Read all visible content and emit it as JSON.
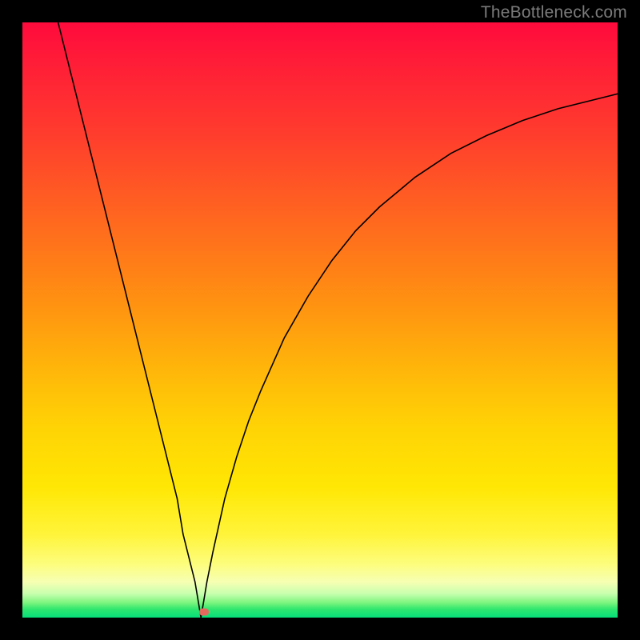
{
  "watermark": "TheBottleneck.com",
  "colors": {
    "background_black": "#000000",
    "curve_stroke": "#000000",
    "marker_fill": "#e46a5e",
    "gradient_stops": [
      "#ff0a3c",
      "#ff1b38",
      "#ff3a2e",
      "#ff6a1e",
      "#ff8e12",
      "#ffb50a",
      "#ffd305",
      "#ffe704",
      "#fff43a",
      "#fdfd7d",
      "#f6ffb3",
      "#c7ffae",
      "#7cf57e",
      "#2fe66e",
      "#05de7a"
    ]
  },
  "chart_data": {
    "type": "line",
    "title": "",
    "xlabel": "",
    "ylabel": "",
    "xlim": [
      0,
      100
    ],
    "ylim": [
      0,
      100
    ],
    "grid": false,
    "series": [
      {
        "name": "left-branch",
        "x": [
          6,
          8,
          10,
          12,
          14,
          16,
          18,
          20,
          22,
          24,
          26,
          27,
          28,
          29,
          29.5,
          30
        ],
        "values": [
          100,
          92,
          84,
          76,
          68,
          60,
          52,
          44,
          36,
          28,
          20,
          14,
          10,
          6,
          3,
          0
        ]
      },
      {
        "name": "right-branch",
        "x": [
          30,
          31,
          32,
          34,
          36,
          38,
          40,
          44,
          48,
          52,
          56,
          60,
          66,
          72,
          78,
          84,
          90,
          96,
          100
        ],
        "values": [
          0,
          6,
          11,
          20,
          27,
          33,
          38,
          47,
          54,
          60,
          65,
          69,
          74,
          78,
          81,
          83.5,
          85.5,
          87,
          88
        ]
      }
    ],
    "marker": {
      "x": 30.5,
      "y": 1
    }
  }
}
